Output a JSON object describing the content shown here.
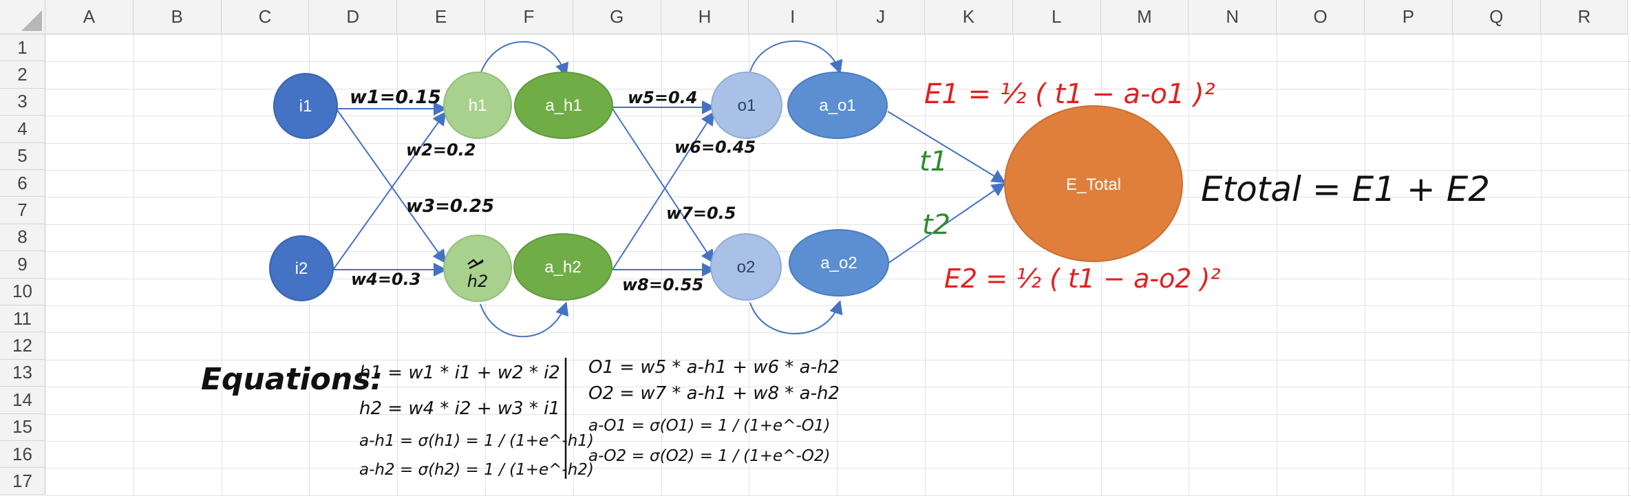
{
  "sheet": {
    "columns": [
      "A",
      "B",
      "C",
      "D",
      "E",
      "F",
      "G",
      "H",
      "I",
      "J",
      "K",
      "L",
      "M",
      "N",
      "O",
      "P",
      "Q",
      "R"
    ],
    "rows": [
      "1",
      "2",
      "3",
      "4",
      "5",
      "6",
      "7",
      "8",
      "9",
      "10",
      "11",
      "12",
      "13",
      "14",
      "15",
      "16",
      "17"
    ]
  },
  "diagram": {
    "nodes": {
      "i1": "i1",
      "i2": "i2",
      "h1": "h1",
      "a_h1": "a_h1",
      "h2": "h2",
      "a_h2": "a_h2",
      "o1": "o1",
      "a_o1": "a_o1",
      "o2": "o2",
      "a_o2": "a_o2",
      "e_total": "E_Total"
    },
    "weights": {
      "w1": "w1=0.15",
      "w2": "w2=0.2",
      "w3": "w3=0.25",
      "w4": "w4=0.3",
      "w5": "w5=0.4",
      "w6": "w6=0.45",
      "w7": "w7=0.5",
      "w8": "w8=0.55"
    },
    "targets": {
      "t1": "t1",
      "t2": "t2"
    },
    "errors": {
      "e1": "E1 = ½ ( t1 − a-o1 )²",
      "e2": "E2 = ½ ( t1 − a-o2 )²",
      "etotal": "Etotal = E1 + E2"
    },
    "colors": {
      "dark_blue": "#4472c4",
      "light_blue": "#a9c1e6",
      "mid_blue": "#5b8fd2",
      "light_green": "#a9d18e",
      "green": "#70ad47",
      "orange": "#e07f3c",
      "arrow": "#4472c4",
      "red": "#e02020",
      "dark_green": "#2e8b2e"
    }
  },
  "equations": {
    "title": "Equations:",
    "left": [
      "h1 = w1 * i1 + w2 * i2",
      "h2 = w4 * i2 + w3 * i1",
      "a-h1 = σ(h1) = 1 / (1+e^-h1)",
      "a-h2 = σ(h2) = 1 / (1+e^-h2)"
    ],
    "right": [
      "O1 = w5 * a-h1 + w6 * a-h2",
      "O2 = w7 * a-h1 + w8 * a-h2",
      "a-O1 = σ(O1) = 1 / (1+e^-O1)",
      "a-O2 = σ(O2) = 1 / (1+e^-O2)"
    ]
  }
}
